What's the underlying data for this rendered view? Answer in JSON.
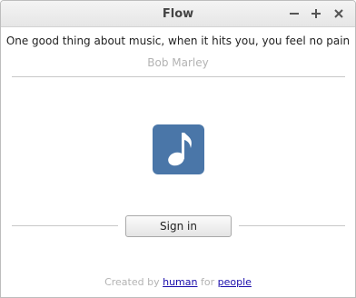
{
  "window": {
    "title": "Flow"
  },
  "quote": {
    "text": "One good thing about music, when it hits you, you feel no pain",
    "author": "Bob Marley"
  },
  "app_icon": {
    "name": "music-note-icon",
    "color": "#4a76a8"
  },
  "signin": {
    "label": "Sign in"
  },
  "footer": {
    "prefix": "Created by",
    "link1": "human",
    "middle": "for",
    "link2": "people"
  },
  "colors": {
    "accent": "#4a76a8",
    "link": "#1a0dab",
    "muted_text": "#b3b3b3"
  }
}
